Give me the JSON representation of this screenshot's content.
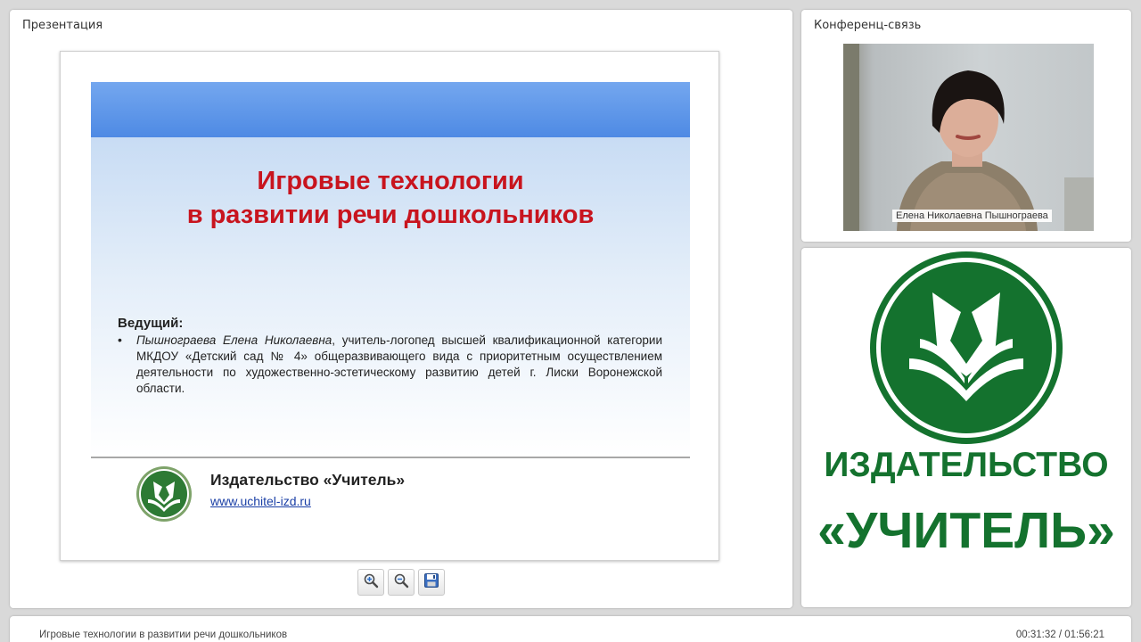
{
  "presentation": {
    "panel_title": "Презентация",
    "slide": {
      "title_line1": "Игровые технологии",
      "title_line2": "в развитии речи дошкольников",
      "host_label": "Ведущий:",
      "bullet": "•",
      "host_name": "Пышнограева Елена Николаевна",
      "host_description": ", учитель-логопед высшей квалификационной категории МКДОУ «Детский сад № 4» общеразвивающего вида с приоритетным осуществлением деятельности по художественно-эстетическому развитию детей г. Лиски Воронежской области.",
      "publisher": "Издательство «Учитель»",
      "url": "www.uchitel-izd.ru"
    },
    "toolbar": {
      "zoom_in_icon": "zoom-in-icon",
      "zoom_out_icon": "zoom-out-icon",
      "save_icon": "floppy-disk-icon"
    }
  },
  "conference": {
    "panel_title": "Конференц-связь",
    "speaker_name": "Елена Николаевна Пышнограева"
  },
  "branding": {
    "line1": "ИЗДАТЕЛЬСТВО",
    "line2": "«УЧИТЕЛЬ»",
    "color": "#14722e"
  },
  "footer": {
    "title": "Игровые технологии в развитии речи дошкольников",
    "time": "00:31:32 / 01:56:21"
  }
}
